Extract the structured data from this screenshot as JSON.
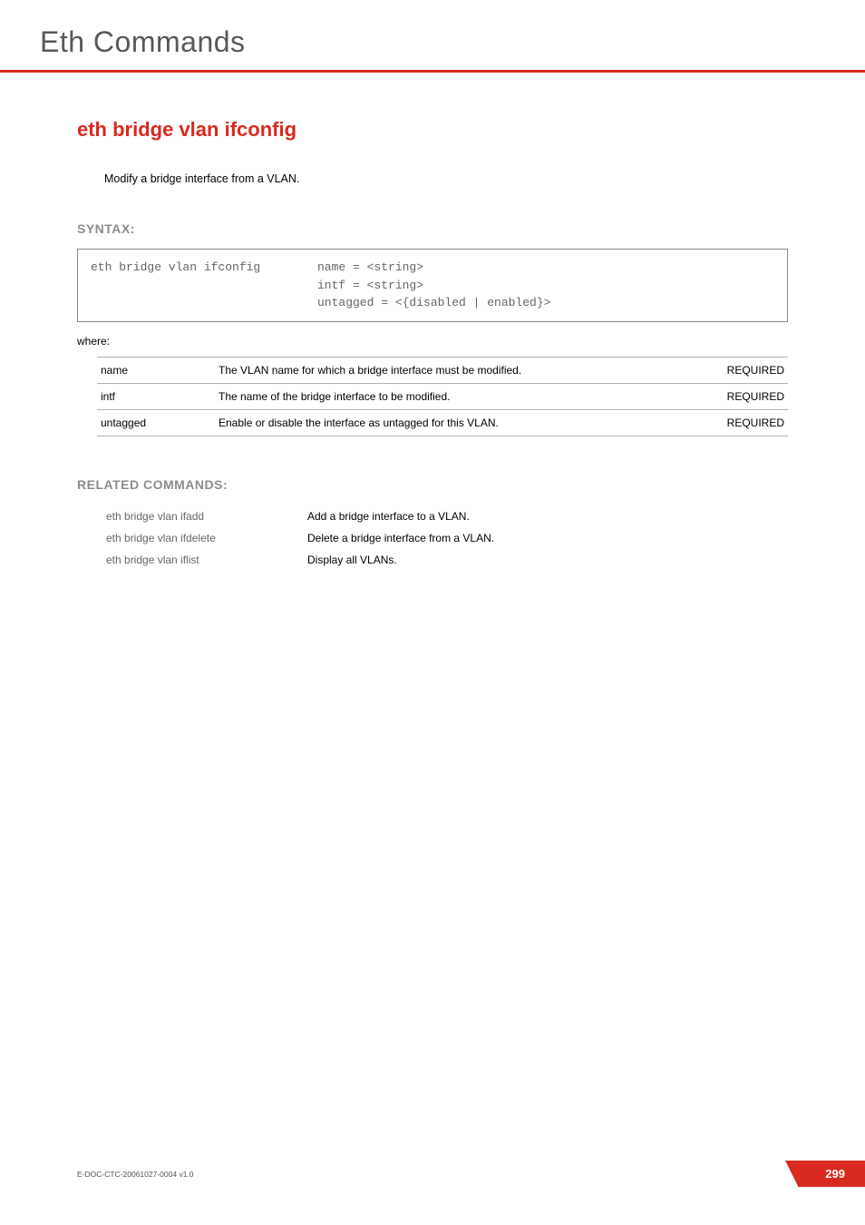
{
  "header": {
    "title": "Eth Commands"
  },
  "command": {
    "title": "eth bridge vlan ifconfig",
    "description": "Modify a bridge interface from a VLAN."
  },
  "syntax": {
    "heading": "SYNTAX:",
    "command": "eth bridge vlan ifconfig",
    "args_line1": "name = <string>",
    "args_line2": "intf = <string>",
    "args_line3": "untagged = <{disabled | enabled}>",
    "where_label": "where:"
  },
  "params": [
    {
      "name": "name",
      "desc": "The VLAN name for which a bridge interface must be modified.",
      "req": "REQUIRED"
    },
    {
      "name": "intf",
      "desc": "The name of the bridge interface to be modified.",
      "req": "REQUIRED"
    },
    {
      "name": "untagged",
      "desc": "Enable or disable the interface as untagged for this VLAN.",
      "req": "REQUIRED"
    }
  ],
  "related": {
    "heading": "RELATED COMMANDS:",
    "items": [
      {
        "cmd": "eth bridge vlan ifadd",
        "desc": "Add a bridge interface to a VLAN."
      },
      {
        "cmd": "eth bridge vlan ifdelete",
        "desc": "Delete a bridge interface from a VLAN."
      },
      {
        "cmd": "eth bridge vlan iflist",
        "desc": "Display all VLANs."
      }
    ]
  },
  "footer": {
    "doc_id": "E-DOC-CTC-20061027-0004 v1.0",
    "page_num": "299"
  }
}
